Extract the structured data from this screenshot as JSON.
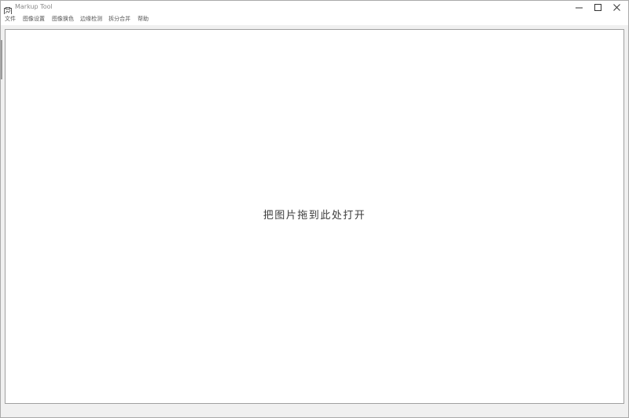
{
  "window": {
    "title": "Markup Tool",
    "icon": "app-icon"
  },
  "window_controls": {
    "minimize_icon": "minimize-icon",
    "maximize_icon": "maximize-icon",
    "close_icon": "close-icon"
  },
  "menu": {
    "items": [
      {
        "label": "文件"
      },
      {
        "label": "图像设置"
      },
      {
        "label": "图像换色"
      },
      {
        "label": "边缘检测"
      },
      {
        "label": "拆分合并"
      },
      {
        "label": "帮助"
      }
    ]
  },
  "canvas": {
    "drop_hint": "把图片拖到此处打开"
  }
}
